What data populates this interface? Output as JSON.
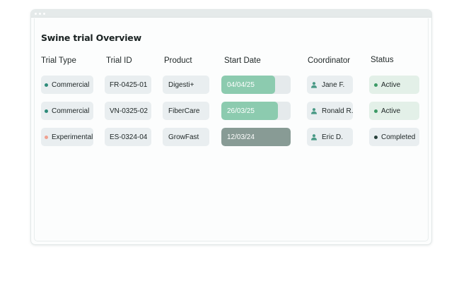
{
  "page": {
    "title": "Swine trial Overview"
  },
  "columns": {
    "trial_type": "Trial Type",
    "trial_id": "Trial ID",
    "product": "Product",
    "start_date": "Start Date",
    "coordinator": "Coordinator",
    "status": "Status"
  },
  "rows": [
    {
      "trial_type": "Commercial",
      "type_color": "#2e8b7a",
      "trial_id": "FR-0425-01",
      "product": "Digesti+",
      "start_date": "04/04/25",
      "progress": 0.78,
      "progress_color": "#8ccbaf",
      "coordinator": "Jane F.",
      "status": "Active",
      "status_color": "#3c9a66"
    },
    {
      "trial_type": "Commercial",
      "type_color": "#2e8b7a",
      "trial_id": "VN-0325-02",
      "product": "FiberCare",
      "start_date": "26/03/25",
      "progress": 0.82,
      "progress_color": "#8ccbaf",
      "coordinator": "Ronald R.",
      "status": "Active",
      "status_color": "#3c9a66"
    },
    {
      "trial_type": "Experimental",
      "type_color": "#f0a08f",
      "trial_id": "ES-0324-04",
      "product": "GrowFast",
      "start_date": "12/03/24",
      "progress": 1.0,
      "progress_color": "#889b95",
      "coordinator": "Eric D.",
      "status": "Completed",
      "status_color": "#27403a"
    }
  ],
  "icons": {
    "coordinator": "person-icon",
    "status": "status-dot-icon",
    "type": "type-dot-icon"
  }
}
